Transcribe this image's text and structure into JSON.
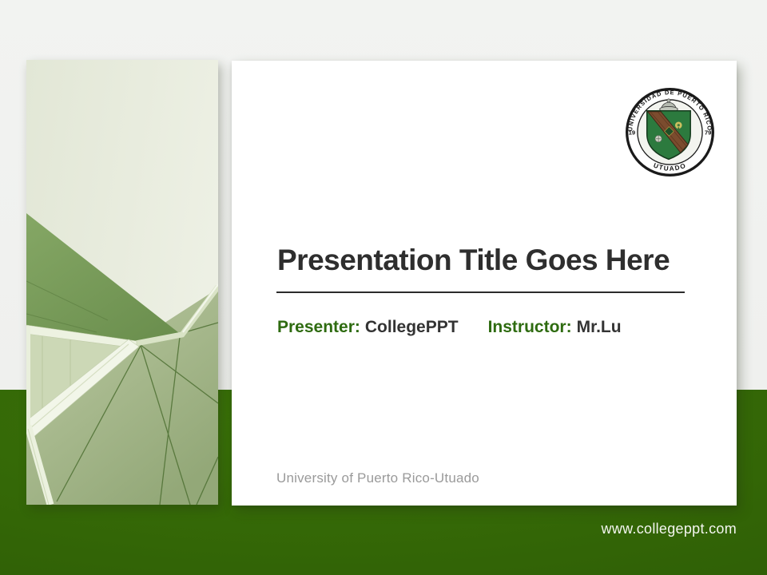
{
  "slide": {
    "title": "Presentation Title Goes Here",
    "presenter_label": "Presenter:",
    "presenter_value": "CollegePPT",
    "instructor_label": "Instructor:",
    "instructor_value": "Mr.Lu",
    "footer": "University of Puerto Rico-Utuado",
    "website": "www.collegeppt.com"
  },
  "seal": {
    "ring_text": "UNIVERSIDAD DE PUERTO RICO",
    "bottom_text": "UTUADO",
    "year_left": "19",
    "year_right": "79"
  },
  "colors": {
    "accent_green": "#2E6B10",
    "background_green": "#336607",
    "background_gray": "#F0F1EF",
    "card_white": "#FFFFFF",
    "title_text": "#2E2E2E",
    "muted_text": "#9A9A9A",
    "website_text": "#F4F6F0",
    "seal_shield_green": "#2C7A3E",
    "seal_band_brown": "#7B4C2E"
  }
}
